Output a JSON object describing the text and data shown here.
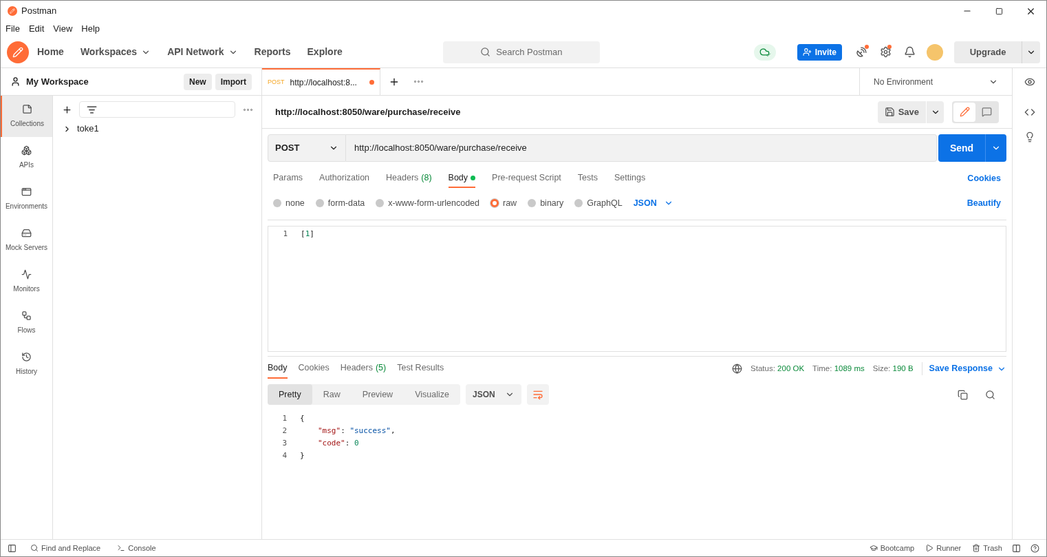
{
  "window": {
    "title": "Postman"
  },
  "menu": [
    "File",
    "Edit",
    "View",
    "Help"
  ],
  "nav": [
    {
      "label": "Home",
      "dropdown": false
    },
    {
      "label": "Workspaces",
      "dropdown": true
    },
    {
      "label": "API Network",
      "dropdown": true
    },
    {
      "label": "Reports",
      "dropdown": false
    },
    {
      "label": "Explore",
      "dropdown": false
    }
  ],
  "search": {
    "placeholder": "Search Postman"
  },
  "header": {
    "invite": "Invite",
    "upgrade": "Upgrade"
  },
  "workspace": {
    "name": "My Workspace",
    "new": "New",
    "import": "Import"
  },
  "sidebar": [
    {
      "label": "Collections",
      "selected": true
    },
    {
      "label": "APIs",
      "selected": false
    },
    {
      "label": "Environments",
      "selected": false
    },
    {
      "label": "Mock Servers",
      "selected": false
    },
    {
      "label": "Monitors",
      "selected": false
    },
    {
      "label": "Flows",
      "selected": false
    },
    {
      "label": "History",
      "selected": false
    }
  ],
  "collections": [
    {
      "name": "toke1",
      "expanded": false
    }
  ],
  "request_tabs": [
    {
      "method": "POST",
      "title": "http://localhost:8...",
      "unsaved": true,
      "selected": true
    }
  ],
  "environment": "No Environment",
  "request": {
    "title": "http://localhost:8050/ware/purchase/receive",
    "save": "Save",
    "method": "POST",
    "url": "http://localhost:8050/ware/purchase/receive",
    "send": "Send"
  },
  "request_options": [
    {
      "label": "Params",
      "selected": false,
      "dot": false
    },
    {
      "label": "Authorization",
      "selected": false,
      "dot": false
    },
    {
      "label": "Headers",
      "count": "(8)",
      "selected": false,
      "dot": false
    },
    {
      "label": "Body",
      "selected": true,
      "dot": true
    },
    {
      "label": "Pre-request Script",
      "selected": false,
      "dot": false
    },
    {
      "label": "Tests",
      "selected": false,
      "dot": false
    },
    {
      "label": "Settings",
      "selected": false,
      "dot": false
    }
  ],
  "cookies_link": "Cookies",
  "body_types": [
    {
      "label": "none",
      "selected": false
    },
    {
      "label": "form-data",
      "selected": false
    },
    {
      "label": "x-www-form-urlencoded",
      "selected": false
    },
    {
      "label": "raw",
      "selected": true
    },
    {
      "label": "binary",
      "selected": false
    },
    {
      "label": "GraphQL",
      "selected": false
    }
  ],
  "body_format": "JSON",
  "beautify": "Beautify",
  "request_body": [
    {
      "number": "1",
      "tokens": [
        {
          "kind": "punct",
          "text": "["
        },
        {
          "kind": "number",
          "text": "1"
        },
        {
          "kind": "punct",
          "text": "]"
        }
      ]
    }
  ],
  "response_tabs": [
    {
      "label": "Body",
      "selected": true
    },
    {
      "label": "Cookies",
      "selected": false
    },
    {
      "label": "Headers",
      "count": "(5)",
      "selected": false
    },
    {
      "label": "Test Results",
      "selected": false
    }
  ],
  "response_meta": [
    {
      "label": "Status:",
      "value": "200 OK"
    },
    {
      "label": "Time:",
      "value": "1089 ms"
    },
    {
      "label": "Size:",
      "value": "190 B"
    }
  ],
  "save_response": "Save Response",
  "view_modes": [
    {
      "label": "Pretty",
      "selected": true
    },
    {
      "label": "Raw",
      "selected": false
    },
    {
      "label": "Preview",
      "selected": false
    },
    {
      "label": "Visualize",
      "selected": false
    }
  ],
  "response_format": "JSON",
  "response_body": [
    {
      "number": "1",
      "tokens": [
        {
          "kind": "punct",
          "text": "{"
        }
      ],
      "children": [
        {
          "number": "2",
          "tokens": [
            {
              "kind": "key",
              "text": "\"msg\""
            },
            {
              "kind": "punct",
              "text": ": "
            },
            {
              "kind": "string",
              "text": "\"success\""
            },
            {
              "kind": "punct",
              "text": ","
            }
          ]
        },
        {
          "number": "3",
          "tokens": [
            {
              "kind": "key",
              "text": "\"code\""
            },
            {
              "kind": "punct",
              "text": ": "
            },
            {
              "kind": "number",
              "text": "0"
            }
          ]
        }
      ]
    },
    {
      "number": "4",
      "tokens": [
        {
          "kind": "punct",
          "text": "}"
        }
      ]
    }
  ],
  "status_bar": {
    "left": [
      "Find and Replace",
      "Console"
    ],
    "right": [
      "Bootcamp",
      "Runner",
      "Trash"
    ]
  }
}
